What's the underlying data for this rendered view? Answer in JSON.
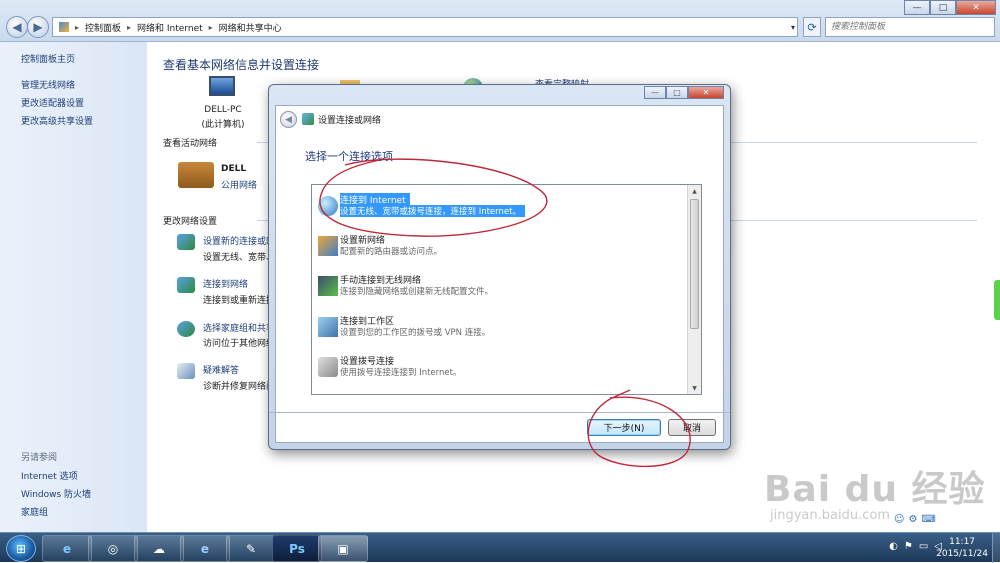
{
  "explorer": {
    "title_hint": "",
    "breadcrumb": [
      "控制面板",
      "网络和 Internet",
      "网络和共享中心"
    ],
    "search_placeholder": "搜索控制面板",
    "window_buttons": {
      "minimize": "—",
      "maximize": "□",
      "close": "✕"
    }
  },
  "leftpane": {
    "home": "控制面板主页",
    "links": [
      "管理无线网络",
      "更改适配器设置",
      "更改高级共享设置"
    ],
    "see_also_title": "另请参阅",
    "see_also": [
      "Internet 选项",
      "Windows 防火墙",
      "家庭组"
    ]
  },
  "main": {
    "heading": "查看基本网络信息并设置连接",
    "pc_name": "DELL-PC",
    "pc_sub": "(此计算机)",
    "full_map_link": "查看完整映射",
    "active_title": "查看活动网络",
    "network_name": "DELL",
    "network_type": "公用网络",
    "change_title": "更改网络设置",
    "tasks": [
      {
        "link": "设置新的连接或网",
        "desc": "设置无线、宽带、"
      },
      {
        "link": "连接到网络",
        "desc": "连接到或重新连接"
      },
      {
        "link": "选择家庭组和共享",
        "desc": "访问位于其他网络"
      },
      {
        "link": "疑难解答",
        "desc": "诊断并修复网络问"
      }
    ]
  },
  "dialog": {
    "title": "设置连接或网络",
    "instruction": "选择一个连接选项",
    "options": [
      {
        "title": "连接到 Internet",
        "desc": "设置无线、宽带或拨号连接，连接到 Internet。",
        "icon": "globe-icon"
      },
      {
        "title": "设置新网络",
        "desc": "配置新的路由器或访问点。",
        "icon": "router-icon"
      },
      {
        "title": "手动连接到无线网络",
        "desc": "连接到隐藏网络或创建新无线配置文件。",
        "icon": "wireless-icon"
      },
      {
        "title": "连接到工作区",
        "desc": "设置到您的工作区的拨号或 VPN 连接。",
        "icon": "workplace-icon"
      },
      {
        "title": "设置拨号连接",
        "desc": "使用拨号连接连接到 Internet。",
        "icon": "phone-icon"
      }
    ],
    "next_button": "下一步(N)",
    "cancel_button": "取消"
  },
  "taskbar": {
    "apps": [
      "e",
      "◎",
      "☁",
      "e",
      "✎",
      "Ps",
      "▣"
    ],
    "time": "11:17",
    "date": "2015/11/24"
  },
  "watermark": {
    "brand": "Bai du 经验",
    "url": "jingyan.baidu.com"
  },
  "colors": {
    "selection": "#3399ff",
    "link": "#1e3e78",
    "annotation": "#c0283a"
  }
}
